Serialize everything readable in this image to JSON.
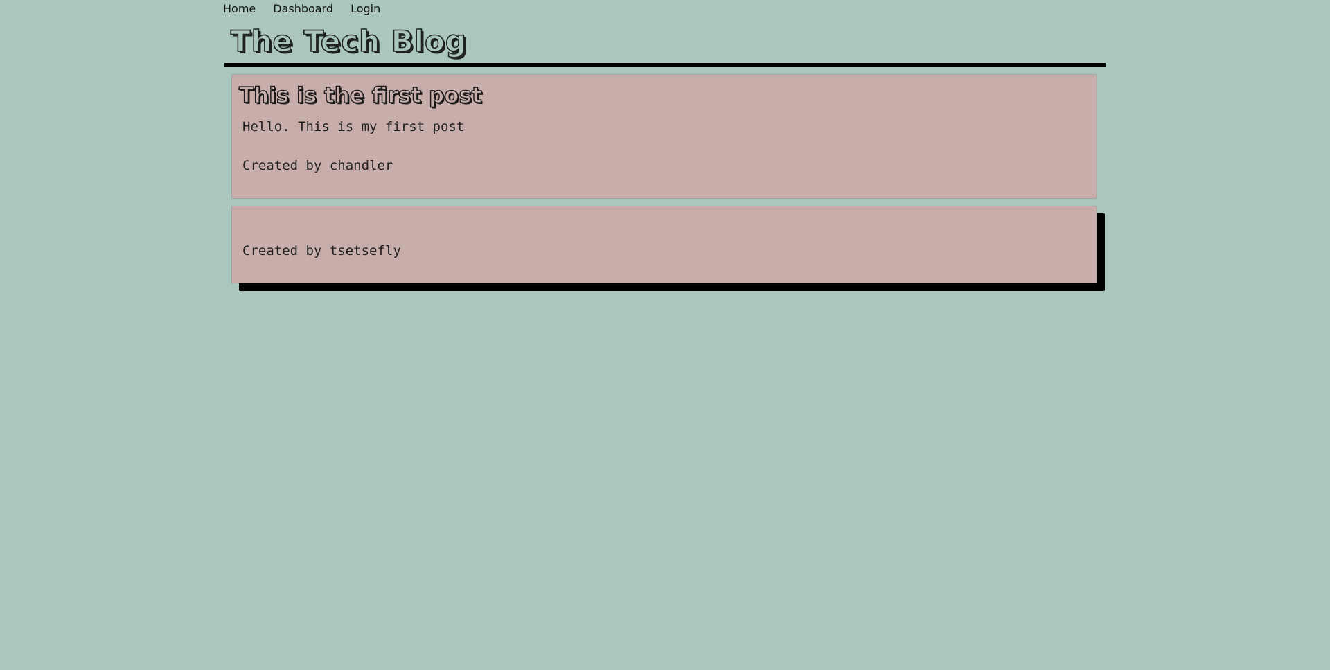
{
  "nav": {
    "items": [
      {
        "label": "Home"
      },
      {
        "label": "Dashboard"
      },
      {
        "label": "Login"
      }
    ]
  },
  "header": {
    "title": "The Tech Blog"
  },
  "posts": [
    {
      "title": "This is the first post",
      "body": "Hello. This is my first post",
      "author_line": "Created by chandler"
    },
    {
      "title": "",
      "body": "",
      "author_line": "Created by tsetsefly"
    }
  ],
  "colors": {
    "page_background": "#abc6bf",
    "card_background": "#c8aeab",
    "accent_dark": "#000000"
  }
}
